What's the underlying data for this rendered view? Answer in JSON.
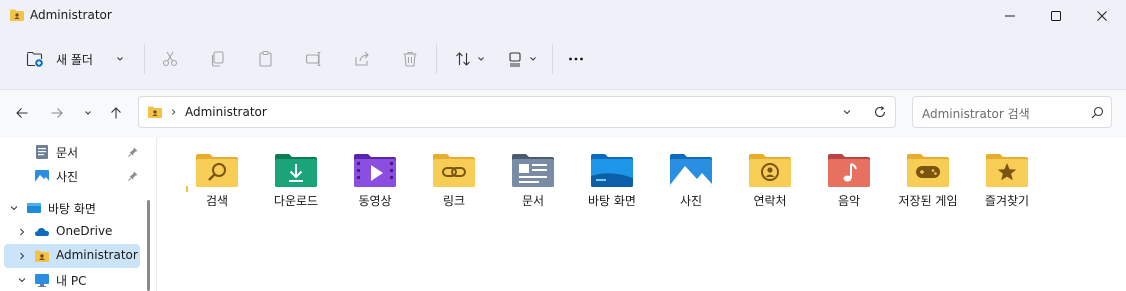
{
  "window": {
    "title": "Administrator"
  },
  "toolbar": {
    "new_folder_label": "새 폴더"
  },
  "address": {
    "crumb": "Administrator"
  },
  "search": {
    "placeholder": "Administrator 검색"
  },
  "sidebar": {
    "items": [
      {
        "label": "문서",
        "icon": "documents-icon",
        "pinned": true
      },
      {
        "label": "사진",
        "icon": "pictures-icon",
        "pinned": true
      },
      {
        "label": "바탕 화면",
        "icon": "desktop-icon",
        "expanded": true
      },
      {
        "label": "OneDrive",
        "icon": "onedrive-icon",
        "expanded": false
      },
      {
        "label": "Administrator",
        "icon": "user-folder-icon",
        "expanded": false,
        "selected": true
      },
      {
        "label": "내 PC",
        "icon": "pc-icon",
        "expanded": true
      }
    ]
  },
  "folders": [
    {
      "label": "검색",
      "icon": "searches-folder-icon",
      "color": "#f4c84a"
    },
    {
      "label": "다운로드",
      "icon": "downloads-folder-icon",
      "color": "#1ba37a"
    },
    {
      "label": "동영상",
      "icon": "videos-folder-icon",
      "color": "#7b3fd1"
    },
    {
      "label": "링크",
      "icon": "links-folder-icon",
      "color": "#f4c84a"
    },
    {
      "label": "문서",
      "icon": "documents-folder-icon",
      "color": "#6d7f96"
    },
    {
      "label": "바탕 화면",
      "icon": "desktop-folder-icon",
      "color": "#1e8bd8"
    },
    {
      "label": "사진",
      "icon": "pictures-folder-icon",
      "color": "#2a8fe0"
    },
    {
      "label": "연락처",
      "icon": "contacts-folder-icon",
      "color": "#f4c84a"
    },
    {
      "label": "음악",
      "icon": "music-folder-icon",
      "color": "#e0625a"
    },
    {
      "label": "저장된 게임",
      "icon": "saved-games-folder-icon",
      "color": "#f4c84a"
    },
    {
      "label": "즐겨찾기",
      "icon": "favorites-folder-icon",
      "color": "#f4c84a"
    }
  ]
}
